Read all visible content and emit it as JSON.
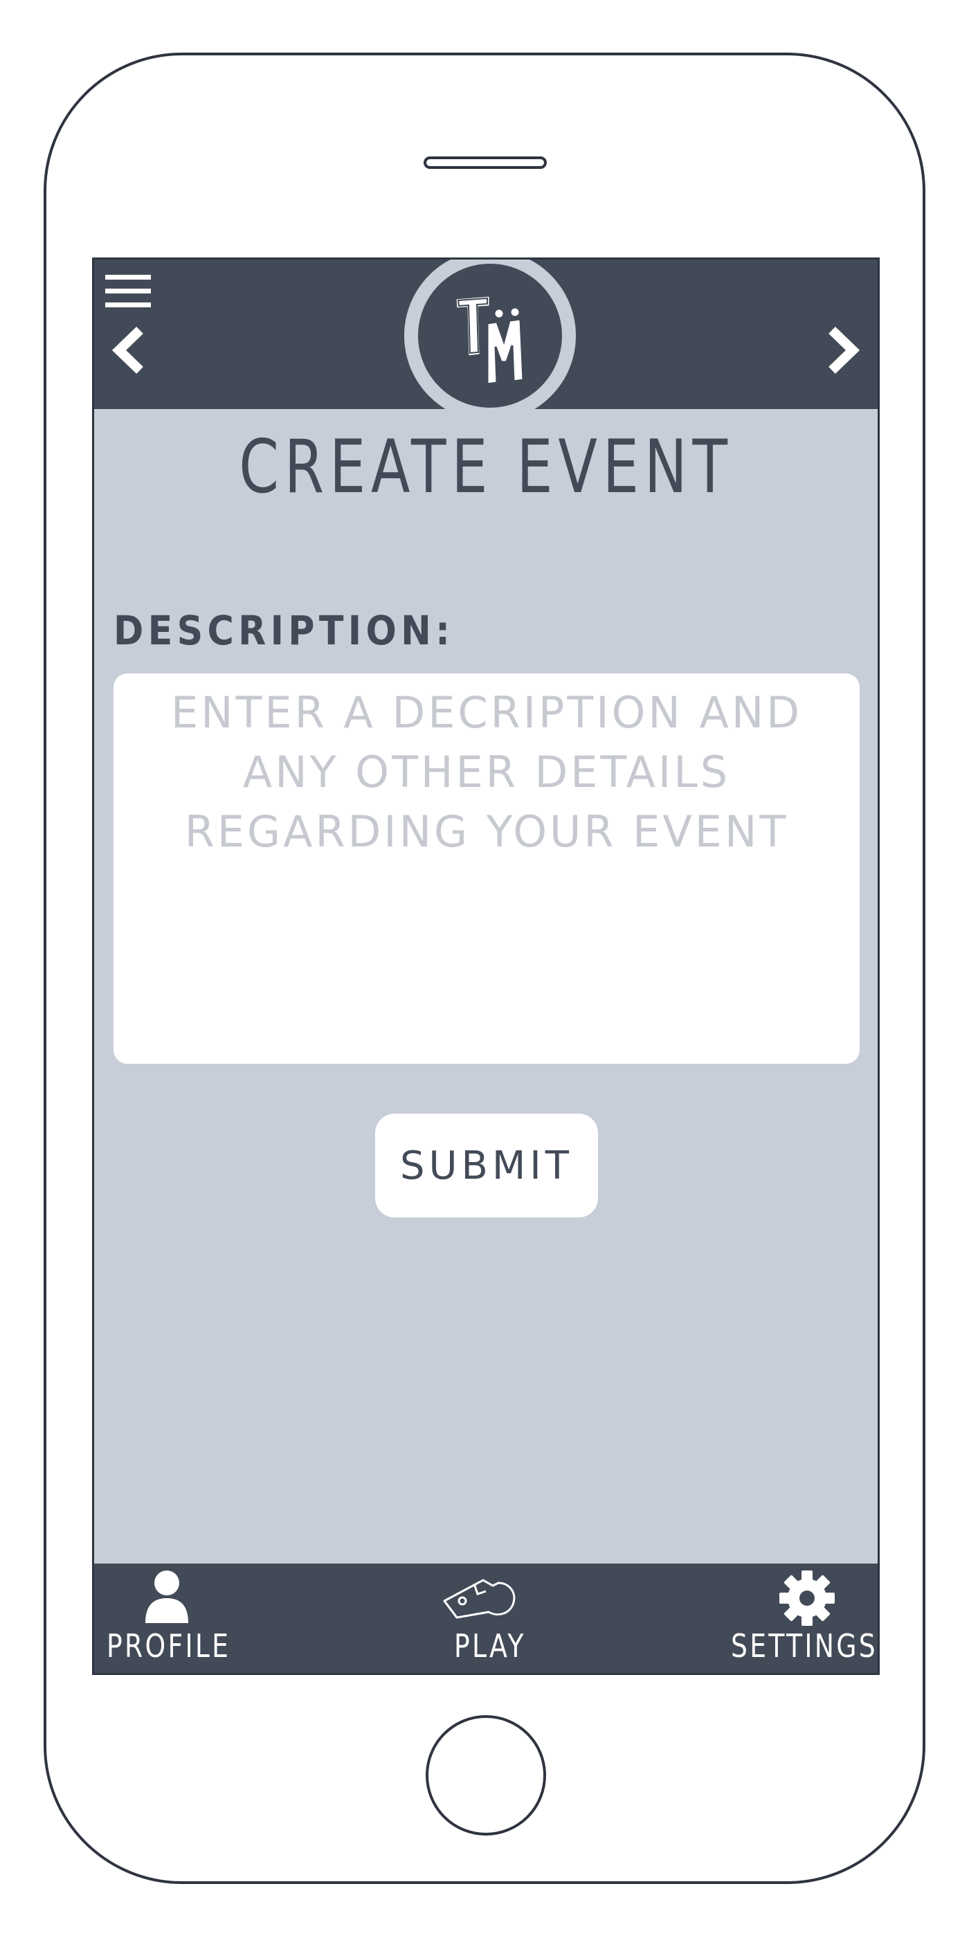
{
  "header": {
    "logo_text": "TM",
    "menu_icon": "hamburger-menu-icon",
    "back_icon": "chevron-left-icon",
    "forward_icon": "chevron-right-icon"
  },
  "page": {
    "title": "CREATE EVENT"
  },
  "form": {
    "description_label": "DESCRIPTION:",
    "description_value": "",
    "description_placeholder": "ENTER A DECRIPTION AND ANY OTHER DETAILS REGARDING YOUR EVENT",
    "submit_label": "SUBMIT"
  },
  "tab_bar": {
    "items": [
      {
        "label": "PROFILE",
        "icon": "person-icon"
      },
      {
        "label": "PLAY",
        "icon": "whistle-icon"
      },
      {
        "label": "SETTINGS",
        "icon": "gear-icon"
      }
    ]
  },
  "colors": {
    "header_bg": "#434a57",
    "screen_bg": "#c8ced8",
    "input_bg": "#ffffff",
    "placeholder": "#c6c9cf"
  }
}
